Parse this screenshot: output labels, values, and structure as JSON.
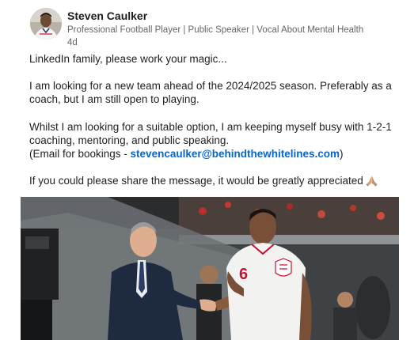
{
  "author": {
    "name": "Steven Caulker",
    "headline": "Professional Football Player | Public Speaker | Vocal About Mental Health",
    "time": "4d"
  },
  "post": {
    "line1": "LinkedIn family, please work your magic...",
    "paragraph2": "I am looking for a new team ahead of the 2024/2025 season. Preferably as a coach, but I am still open to playing.",
    "paragraph3_text": "Whilst I am looking for a suitable option, I am keeping myself busy with 1-2-1 coaching, mentoring, and public speaking.",
    "email_prefix": "(Email for bookings - ",
    "email": "stevencaulker@behindthewhitelines.com",
    "email_suffix": ")",
    "closing": "If you could please share the message, it would be greatly appreciated",
    "closing_emoji": "praying-hands-icon"
  },
  "photo": {
    "jersey_number": "6",
    "description_icon": "handshake-photo"
  },
  "colors": {
    "link": "#0a66c2",
    "secondary_text": "#666666",
    "primary_text": "#1d1d1d"
  }
}
